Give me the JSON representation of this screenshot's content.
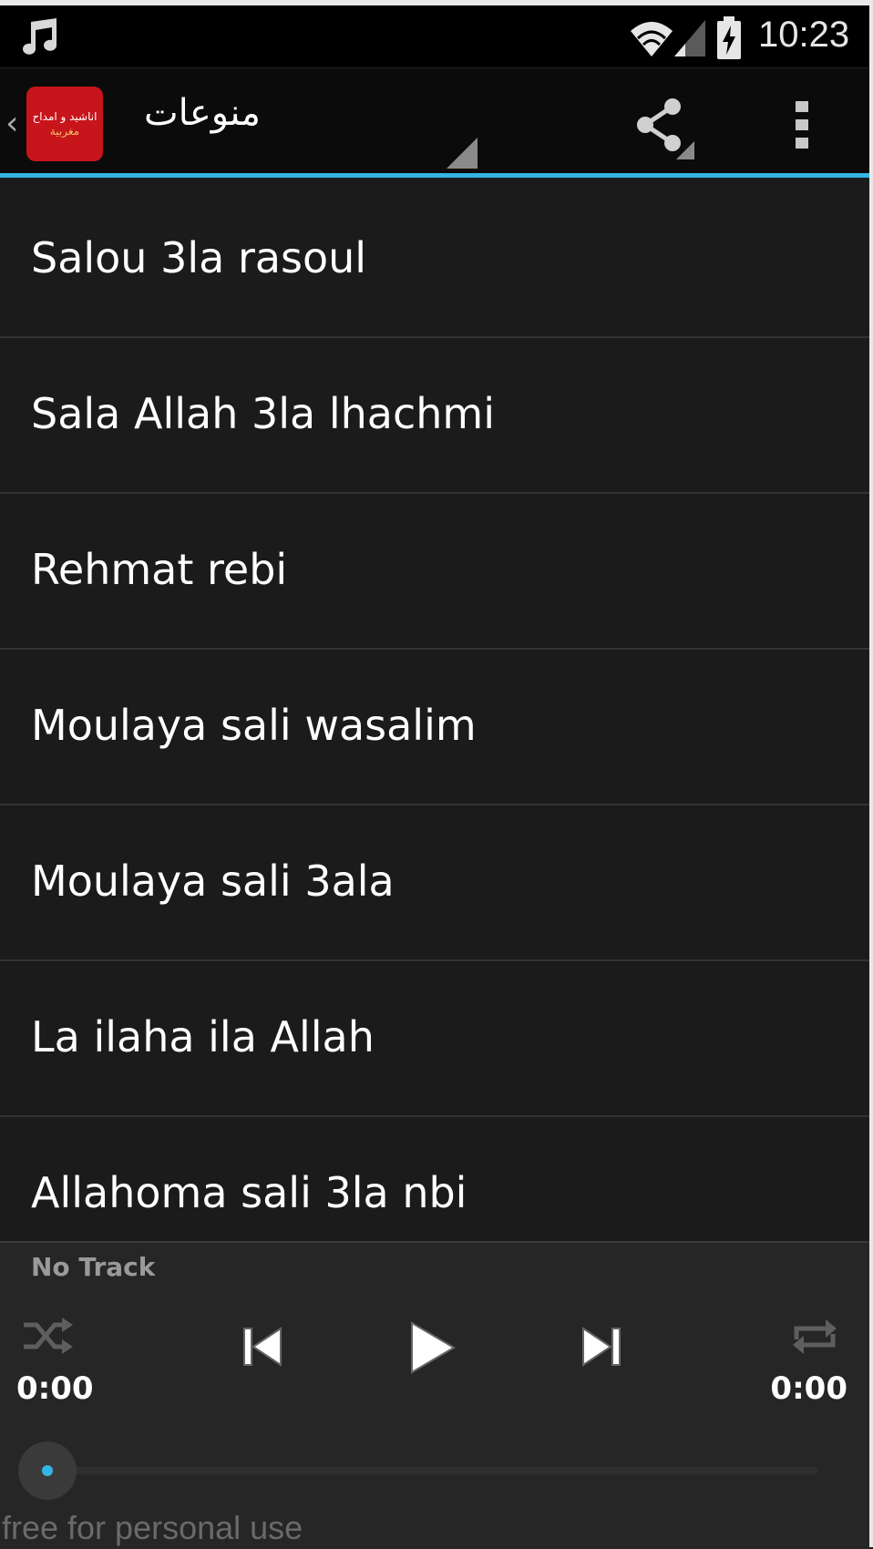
{
  "status_bar": {
    "time": "10:23",
    "icons": [
      "music-note-icon",
      "wifi-icon",
      "signal-icon",
      "battery-charging-icon"
    ]
  },
  "action_bar": {
    "logo_line1": "اناشيد و امداح",
    "logo_line2": "مغربية",
    "title": "منوعات",
    "share_icon": "share-icon",
    "overflow_icon": "overflow-menu-icon",
    "accent_color": "#33b5e5"
  },
  "tracks": [
    "Salou 3la rasoul",
    "Sala Allah 3la lhachmi",
    "Rehmat rebi",
    "Moulaya sali wasalim",
    "Moulaya sali 3ala",
    "La ilaha ila Allah",
    "Allahoma sali 3la nbi"
  ],
  "player": {
    "track_title": "No Track",
    "current_time": "0:00",
    "total_time": "0:00",
    "progress": 0,
    "controls": [
      "shuffle-icon",
      "previous-icon",
      "play-icon",
      "next-icon",
      "repeat-icon"
    ]
  },
  "watermark": "free for personal use"
}
